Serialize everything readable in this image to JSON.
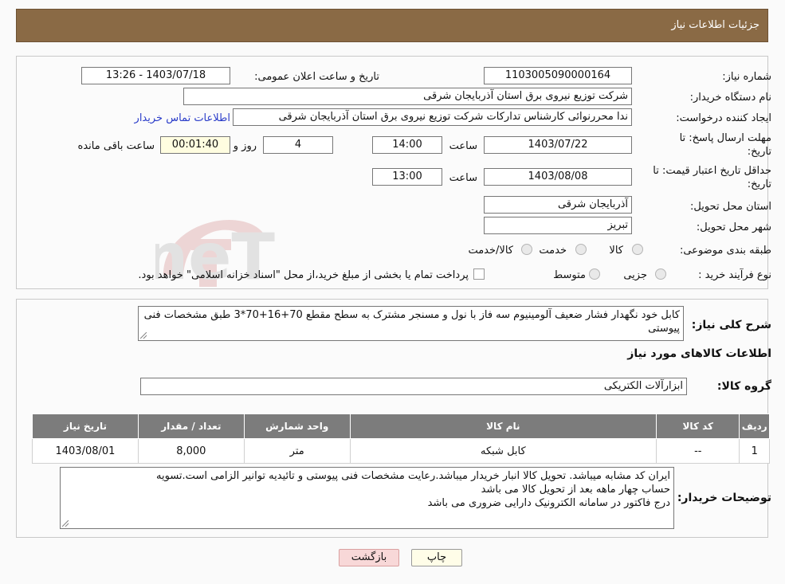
{
  "header": {
    "title": "جزئیات اطلاعات نیاز"
  },
  "form": {
    "need_number_label": "شماره نیاز:",
    "need_number": "1103005090000164",
    "announce_label": "تاریخ و ساعت اعلان عمومی:",
    "announce_value": "1403/07/18 - 13:26",
    "buyer_org_label": "نام دستگاه خریدار:",
    "buyer_org": "شرکت توزیع نیروی برق استان آذربایجان شرقی",
    "creator_label": "ایجاد کننده درخواست:",
    "creator": "ندا محررنوائی کارشناس تدارکات شرکت توزیع نیروی برق استان آذربایجان شرقی",
    "contact_link": "اطلاعات تماس خریدار",
    "reply_deadline_label_1": "مهلت ارسال پاسخ: تا",
    "reply_deadline_label_2": "تاریخ:",
    "reply_date": "1403/07/22",
    "time_label": "ساعت",
    "reply_time": "14:00",
    "days_value": "4",
    "days_label": "روز و",
    "remaining_time": "00:01:40",
    "remaining_label": "ساعت باقی مانده",
    "price_validity_label_1": "حداقل تاریخ اعتبار قیمت: تا",
    "price_validity_label_2": "تاریخ:",
    "price_date": "1403/08/08",
    "price_time": "13:00",
    "province_label": "استان محل تحویل:",
    "province": "آذربایجان شرقی",
    "city_label": "شهر محل تحویل:",
    "city": "تبریز",
    "category_label": "طبقه بندی موضوعی:",
    "category_options": [
      "کالا",
      "خدمت",
      "کالا/خدمت"
    ],
    "process_label": "نوع فرآیند خرید :",
    "process_options": [
      "جزیی",
      "متوسط"
    ],
    "process_note": "پرداخت تمام یا بخشی از مبلغ خرید،از محل \"اسناد خزانه اسلامی\" خواهد بود."
  },
  "summary": {
    "label": "شرح کلی نیاز:",
    "text": "کابل خود نگهدار فشار ضعیف آلومینیوم سه فاز با نول و مسنجر مشترک به سطح مقطع 70+16+70*3 طبق مشخصات فنی پیوستی"
  },
  "goods_section_title": "اطلاعات کالاهای مورد نیاز",
  "goods_group": {
    "label": "گروه کالا:",
    "value": "ابزارآلات الکتریکی"
  },
  "table": {
    "headers": [
      "ردیف",
      "کد کالا",
      "نام کالا",
      "واحد شمارش",
      "تعداد / مقدار",
      "تاریخ نیاز"
    ],
    "rows": [
      [
        "1",
        "--",
        "کابل شبکه",
        "متر",
        "8,000",
        "1403/08/01"
      ]
    ]
  },
  "buyer_notes": {
    "label": "توضیحات خریدار:",
    "lines": [
      "ایران کد مشابه میباشد. تحویل کالا انبار خریدار میباشد.رعایت مشخصات فنی پیوستی و تائیدیه توانیر الزامی است.تسویه",
      "حساب چهار ماهه بعد از تحویل کالا می باشد",
      "درج فاکتور در سامانه الکترونیک دارایی ضروری می باشد"
    ]
  },
  "buttons": {
    "print": "چاپ",
    "back": "بازگشت"
  },
  "watermark": {
    "text": "AriaTender.neT"
  }
}
